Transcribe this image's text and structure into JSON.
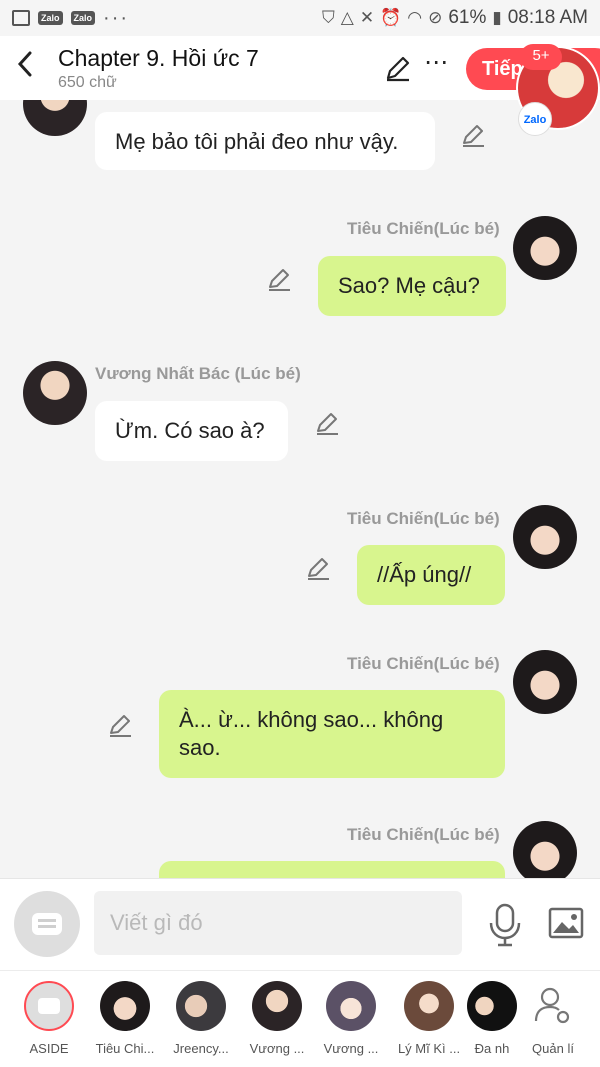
{
  "status_bar": {
    "zalo1": "Zalo",
    "zalo2": "Zalo",
    "dots": "···",
    "battery": "61%",
    "time": "08:18 AM"
  },
  "header": {
    "title": "Chapter 9. Hồi ức 7",
    "subtitle": "650 chữ",
    "next_label": "Tiếp",
    "badge": "5+",
    "zalo_label": "Zalo"
  },
  "messages": [
    {
      "name": "",
      "text": "Mẹ bảo tôi phải đeo như vậy.",
      "side": "left"
    },
    {
      "name": "Tiêu Chiến(Lúc bé)",
      "text": "Sao? Mẹ cậu?",
      "side": "right"
    },
    {
      "name": "Vương Nhất Bác (Lúc bé)",
      "text": "Ừm. Có sao à?",
      "side": "left"
    },
    {
      "name": "Tiêu Chiến(Lúc bé)",
      "text": "//Ấp úng//",
      "side": "right"
    },
    {
      "name": "Tiêu Chiến(Lúc bé)",
      "text": "À... ừ... không sao... không sao.",
      "side": "right"
    },
    {
      "name": "Tiêu Chiến(Lúc bé)",
      "text": "",
      "side": "right"
    }
  ],
  "composer": {
    "placeholder": "Viết gì đó"
  },
  "characters": [
    {
      "label": "ASIDE"
    },
    {
      "label": "Tiêu Chi..."
    },
    {
      "label": "Jreency..."
    },
    {
      "label": "Vương ..."
    },
    {
      "label": "Vương ..."
    },
    {
      "label": "Lý Mĩ Kì ..."
    },
    {
      "label": "Đa nh"
    },
    {
      "label": "Quản lí"
    }
  ]
}
